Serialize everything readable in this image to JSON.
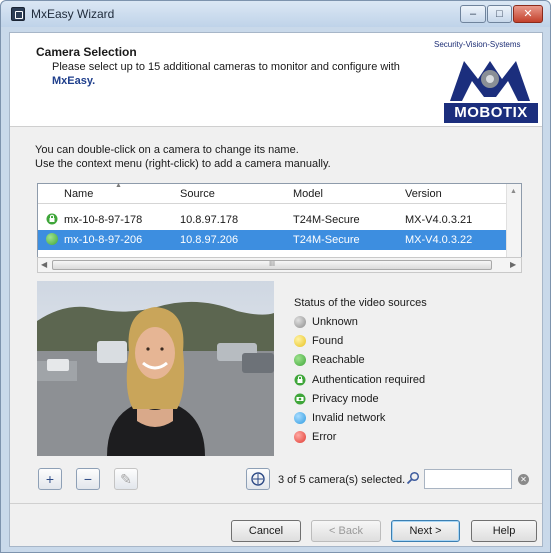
{
  "window": {
    "title": "MxEasy Wizard",
    "minimize_glyph": "–",
    "maximize_glyph": "□",
    "close_glyph": "✕"
  },
  "header": {
    "title": "Camera Selection",
    "description_line1": "Please select up to 15 additional cameras to monitor and configure with",
    "brand_name": "MxEasy.",
    "logo_tagline": "Security-Vision-Systems",
    "logo_text": "MOBOTIX"
  },
  "intro": {
    "line1": "You can double-click on a camera to change its name.",
    "line2": "Use the context menu (right-click) to add a camera manually."
  },
  "camera_list": {
    "columns": [
      "Name",
      "Source",
      "Model",
      "Version"
    ],
    "rows": [
      {
        "name": "mx-10-8-97-178",
        "source": "10.8.97.178",
        "model": "T24M-Secure",
        "version": "MX-V4.0.3.21",
        "status": "Authentication required",
        "selected": false
      },
      {
        "name": "mx-10-8-97-206",
        "source": "10.8.97.206",
        "model": "T24M-Secure",
        "version": "MX-V4.0.3.22",
        "status": "Reachable",
        "selected": true
      }
    ],
    "scroll_grip": "III"
  },
  "status_legend": {
    "title": "Status of the video sources",
    "items": [
      {
        "label": "Unknown",
        "color": "#9a9a9a"
      },
      {
        "label": "Found",
        "color": "#f2d23a"
      },
      {
        "label": "Reachable",
        "color": "#3fa63a"
      },
      {
        "label": "Authentication required",
        "color": "#3fa63a",
        "icon": "lock-icon"
      },
      {
        "label": "Privacy mode",
        "color": "#3fa63a",
        "icon": "privacy-icon"
      },
      {
        "label": "Invalid network",
        "color": "#2f9be0"
      },
      {
        "label": "Error",
        "color": "#e03a32"
      }
    ]
  },
  "toolbar": {
    "add_glyph": "+",
    "remove_glyph": "−",
    "edit_glyph": "✎",
    "count_text": "3 of 5 camera(s) selected.",
    "search_value": ""
  },
  "buttons": {
    "cancel": "Cancel",
    "back": "< Back",
    "next": "Next >",
    "help": "Help"
  },
  "colors": {
    "accent": "#3d8ee0",
    "brand": "#1b2e7d"
  }
}
